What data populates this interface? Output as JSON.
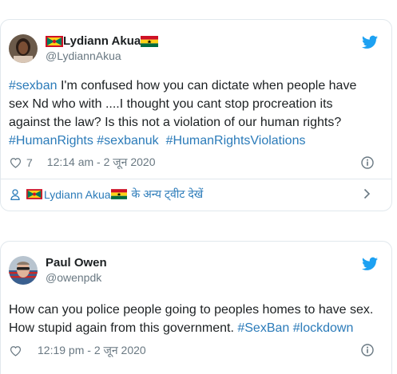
{
  "tweets": [
    {
      "display_name": "Lydiann Akua",
      "handle": "@LydiannAkua",
      "text_parts": [
        {
          "t": "#sexban",
          "tag": true
        },
        {
          "t": " I'm confused how you can dictate when people have sex Nd who with ....I thought you cant stop procreation its against the law? Is this not a violation of our human rights? ",
          "tag": false
        },
        {
          "t": "#HumanRights",
          "tag": true
        },
        {
          "t": " ",
          "tag": false
        },
        {
          "t": "#sexbanuk",
          "tag": true
        },
        {
          "t": "  ",
          "tag": false
        },
        {
          "t": "#HumanRightsViolations",
          "tag": true
        }
      ],
      "likes": "7",
      "timestamp": "12:14 am - 2 जून 2020",
      "more_from_prefix": "Lydiann Akua",
      "more_from_suffix": " के अन्य ट्वीट देखें"
    },
    {
      "display_name": "Paul Owen",
      "handle": "@owenpdk",
      "text_parts": [
        {
          "t": "How can you police people going to peoples homes to have sex. How stupid again from this government. ",
          "tag": false
        },
        {
          "t": "#SexBan",
          "tag": true
        },
        {
          "t": " ",
          "tag": false
        },
        {
          "t": "#lockdown",
          "tag": true
        }
      ],
      "likes": "",
      "timestamp": "12:19 pm - 2 जून 2020"
    }
  ],
  "colors": {
    "link": "#2b7bb9",
    "muted": "#697882",
    "twitter_blue": "#1da1f2",
    "border": "#e1e8ed"
  },
  "icons": {
    "brand": "twitter-bird-icon",
    "like": "heart-icon",
    "info": "info-icon",
    "profile": "person-icon",
    "more": "chevron-right-icon",
    "flag": "grenada-flag-icon"
  }
}
